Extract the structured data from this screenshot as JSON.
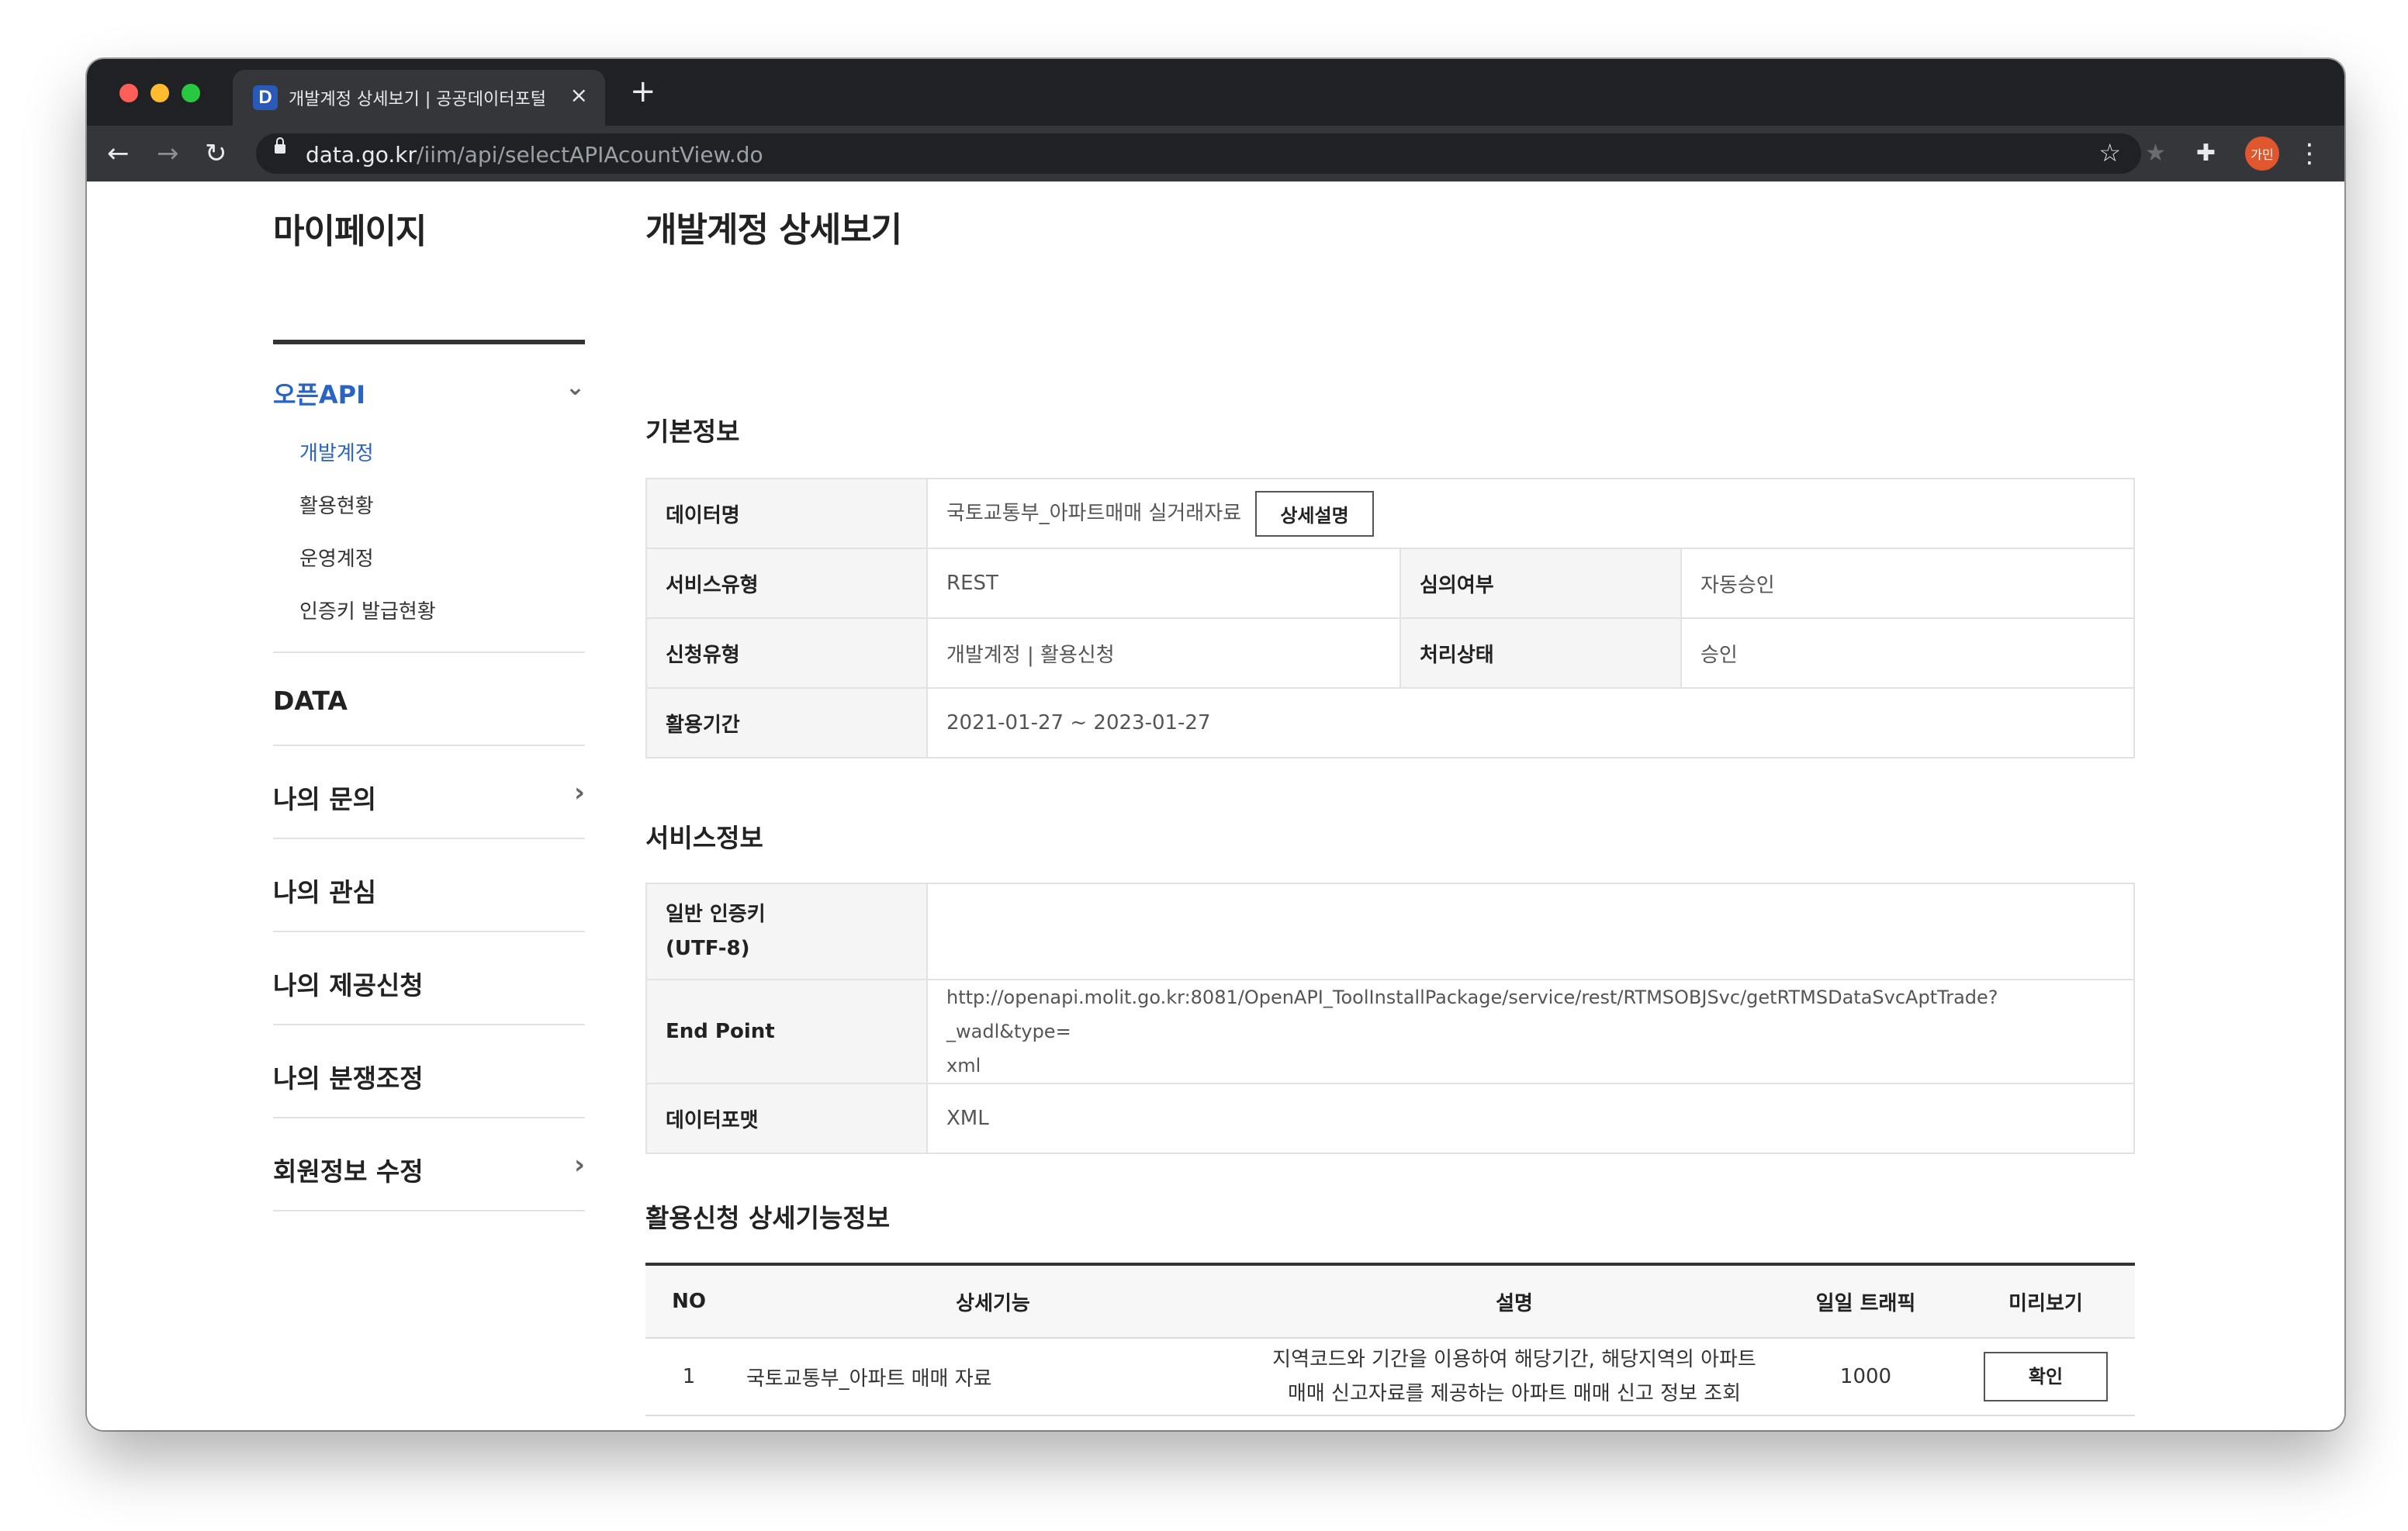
{
  "browser": {
    "tab_title": "개발계정 상세보기 | 공공데이터포털",
    "favicon_letter": "D",
    "url_host": "data.go.kr",
    "url_path": "/iim/api/selectAPIAcountView.do",
    "profile_initials": "가민"
  },
  "sidebar": {
    "title": "마이페이지",
    "open_api": {
      "label": "오픈API",
      "items": [
        "개발계정",
        "활용현황",
        "운영계정",
        "인증키 발급현황"
      ]
    },
    "menu": [
      "DATA",
      "나의 문의",
      "나의 관심",
      "나의 제공신청",
      "나의 분쟁조정",
      "회원정보 수정"
    ]
  },
  "main": {
    "title": "개발계정 상세보기",
    "basic": {
      "heading": "기본정보",
      "data_name_label": "데이터명",
      "data_name_value": "국토교통부_아파트매매 실거래자료",
      "detail_button": "상세설명",
      "service_type_label": "서비스유형",
      "service_type_value": "REST",
      "review_label": "심의여부",
      "review_value": "자동승인",
      "apply_type_label": "신청유형",
      "apply_type_value": "개발계정 | 활용신청",
      "status_label": "처리상태",
      "status_value": "승인",
      "period_label": "활용기간",
      "period_value": "2021-01-27 ~ 2023-01-27"
    },
    "service": {
      "heading": "서비스정보",
      "key_label_1": "일반 인증키",
      "key_label_2": "(UTF-8)",
      "key_value": "",
      "endpoint_label": "End Point",
      "endpoint_value_1": "http://openapi.molit.go.kr:8081/OpenAPI_ToolInstallPackage/service/rest/RTMSOBJSvc/getRTMSDataSvcAptTrade?_wadl&type=",
      "endpoint_value_2": "xml",
      "format_label": "데이터포맷",
      "format_value": "XML"
    },
    "functions": {
      "heading": "활용신청 상세기능정보",
      "columns": [
        "NO",
        "상세기능",
        "설명",
        "일일 트래픽",
        "미리보기"
      ],
      "rows": [
        {
          "no": "1",
          "name": "국토교통부_아파트 매매 자료",
          "desc_1": "지역코드와 기간을 이용하여 해당기간, 해당지역의 아파트",
          "desc_2": "매매 신고자료를 제공하는 아파트 매매 신고 정보 조회",
          "traffic": "1000",
          "preview_button": "확인"
        }
      ]
    }
  }
}
